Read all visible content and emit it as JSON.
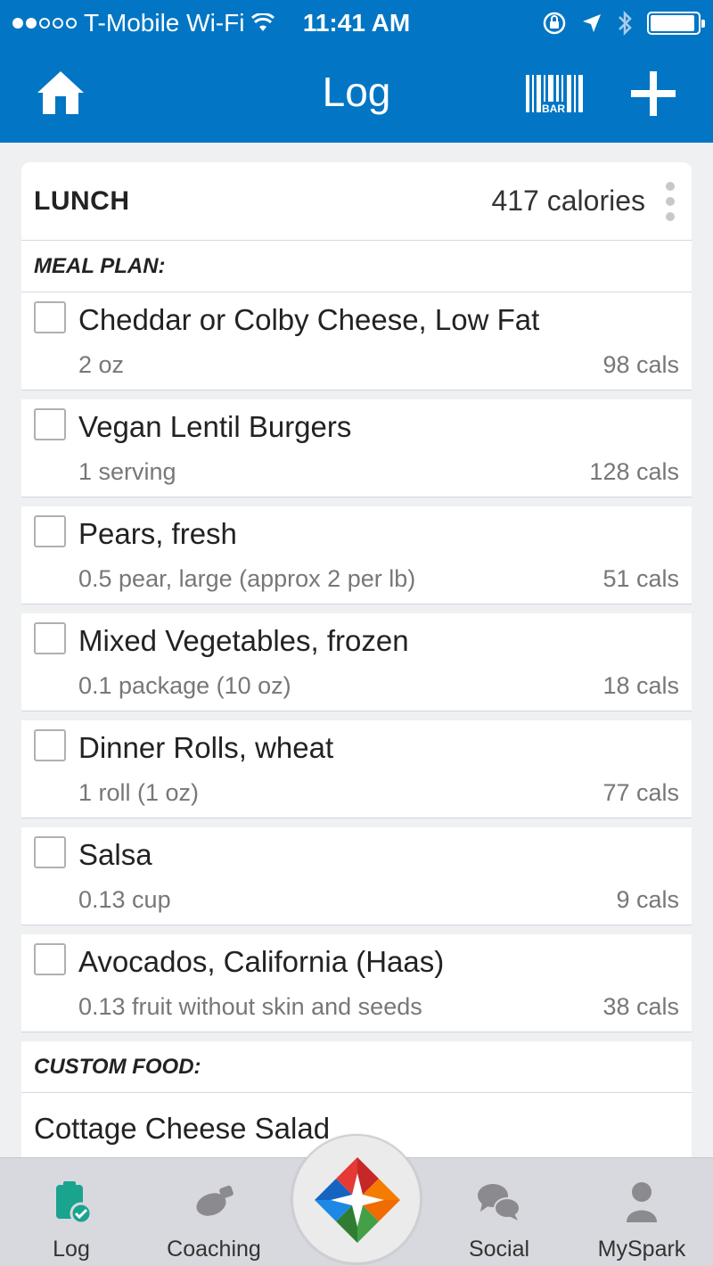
{
  "status_bar": {
    "carrier": "T-Mobile Wi-Fi",
    "time": "11:41 AM",
    "signal_dots_filled": 2,
    "signal_dots_total": 5,
    "icons": [
      "wifi-icon",
      "rotation-lock-icon",
      "location-icon",
      "bluetooth-icon",
      "battery-icon"
    ],
    "battery_level": 0.95
  },
  "nav": {
    "title": "Log",
    "barcode_label": "BAR",
    "icons": [
      "home-icon",
      "barcode-scanner-icon",
      "add-icon"
    ]
  },
  "meal": {
    "name": "LUNCH",
    "calories": "417 calories",
    "meal_plan_label": "MEAL PLAN:",
    "custom_food_label": "CUSTOM FOOD:",
    "items": [
      {
        "name": "Cheddar or Colby Cheese, Low Fat",
        "serving": "2 oz",
        "cals": "98 cals"
      },
      {
        "name": "Vegan Lentil Burgers",
        "serving": "1 serving",
        "cals": "128 cals"
      },
      {
        "name": "Pears, fresh",
        "serving": "0.5 pear, large (approx 2 per lb)",
        "cals": "51 cals"
      },
      {
        "name": "Mixed Vegetables, frozen",
        "serving": "0.1 package (10 oz)",
        "cals": "18 cals"
      },
      {
        "name": "Dinner Rolls, wheat",
        "serving": "1 roll (1 oz)",
        "cals": "77 cals"
      },
      {
        "name": "Salsa",
        "serving": "0.13 cup",
        "cals": "9 cals"
      },
      {
        "name": "Avocados, California (Haas)",
        "serving": "0.13 fruit without skin and seeds",
        "cals": "38 cals"
      }
    ],
    "custom_items": [
      {
        "name": "Cottage Cheese Salad"
      }
    ]
  },
  "tabs": [
    {
      "label": "Log",
      "icon": "log-clipboard-icon",
      "active": true
    },
    {
      "label": "Coaching",
      "icon": "whistle-icon",
      "active": false
    },
    {
      "label": "",
      "icon": "spark-logo-icon",
      "active": false
    },
    {
      "label": "Social",
      "icon": "chat-bubbles-icon",
      "active": false
    },
    {
      "label": "MySpark",
      "icon": "person-icon",
      "active": false
    }
  ],
  "colors": {
    "brand_blue": "#0276c4",
    "active_tab": "#1aa38f",
    "inactive_icon": "#8a8a8f"
  }
}
